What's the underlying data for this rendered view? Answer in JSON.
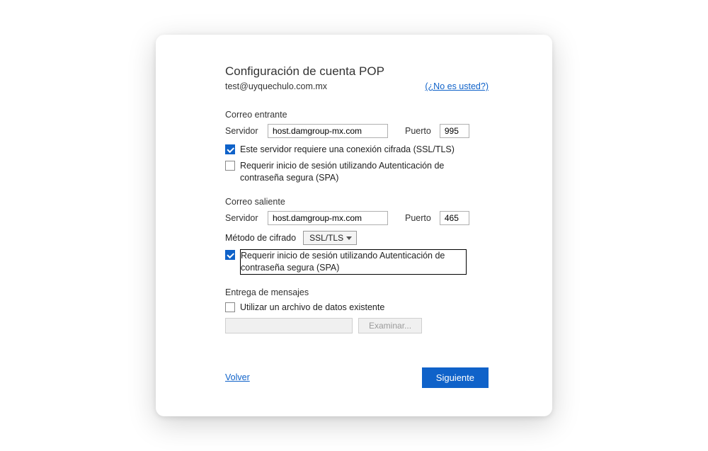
{
  "header": {
    "title": "Configuración de cuenta POP",
    "email": "test@uyquechulo.com.mx",
    "not_you": "(¿No es usted?)"
  },
  "incoming": {
    "section": "Correo entrante",
    "server_label": "Servidor",
    "server_value": "host.damgroup-mx.com",
    "port_label": "Puerto",
    "port_value": "995",
    "ssl_required": "Este servidor requiere una conexión cifrada (SSL/TLS)",
    "spa_label": "Requerir inicio de sesión utilizando Autenticación de contraseña segura (SPA)"
  },
  "outgoing": {
    "section": "Correo saliente",
    "server_label": "Servidor",
    "server_value": "host.damgroup-mx.com",
    "port_label": "Puerto",
    "port_value": "465",
    "method_label": "Método de cifrado",
    "method_value": "SSL/TLS",
    "spa_label": "Requerir inicio de sesión utilizando Autenticación de contraseña segura (SPA)"
  },
  "delivery": {
    "section": "Entrega de mensajes",
    "use_existing": "Utilizar un archivo de datos existente",
    "browse": "Examinar..."
  },
  "footer": {
    "back": "Volver",
    "next": "Siguiente"
  }
}
